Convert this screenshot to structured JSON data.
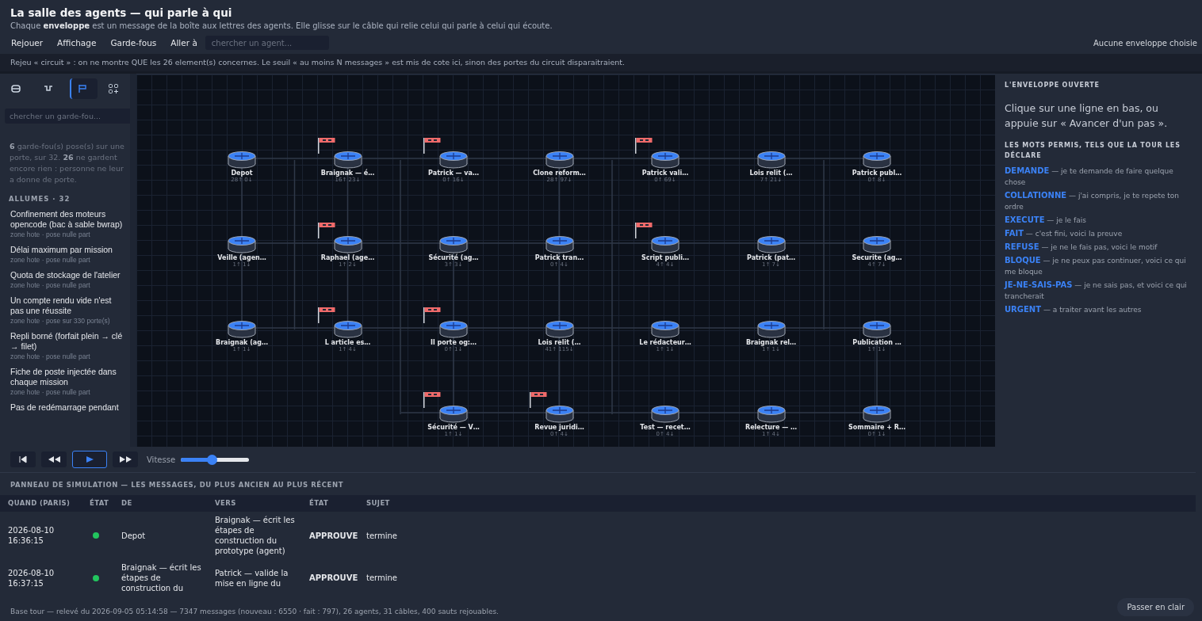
{
  "header": {
    "title": "La salle des agents — qui parle à qui",
    "subtitle": "Chaque **enveloppe** est un message de la boîte aux lettres des agents. Elle glisse sur le câble qui relie celui qui parle à celui qui écoute."
  },
  "menu": {
    "items": [
      "Rejouer",
      "Affichage",
      "Garde-fous",
      "Aller à"
    ],
    "search_placeholder": "chercher un agent...",
    "selection": "Aucune enveloppe choisie"
  },
  "notice": "Rejeu « circuit » : on ne montre QUE les 26 element(s) concernes. Le seuil « au moins N messages » est mis de cote ici, sinon des portes du circuit disparaitraient.",
  "sidebar": {
    "tools": [
      {
        "kind": "agents",
        "selected": false
      },
      {
        "kind": "cables",
        "selected": false
      },
      {
        "kind": "guards",
        "selected": true
      },
      {
        "kind": "grid",
        "selected": false
      }
    ],
    "search_placeholder": "chercher un garde-fou...",
    "summary": "**6** garde-fou(s) pose(s) sur une porte, sur 32. **26** ne gardent encore rien : personne ne leur a donne de porte.",
    "section": "ALLUMES · 32",
    "items": [
      {
        "title": "Confinement des moteurs opencode (bac à sable bwrap)",
        "meta": "zone hote · pose nulle part"
      },
      {
        "title": "Délai maximum par mission",
        "meta": "zone hote · pose nulle part"
      },
      {
        "title": "Quota de stockage de l'atelier",
        "meta": "zone hote · pose nulle part"
      },
      {
        "title": "Un compte rendu vide n'est pas une réussite",
        "meta": "zone hote · pose sur 330 porte(s)"
      },
      {
        "title": "Repli borné (forfait plein → clé → filet)",
        "meta": "zone hote · pose nulle part"
      },
      {
        "title": "Fiche de poste injectée dans chaque mission",
        "meta": "zone hote · pose nulle part"
      },
      {
        "title": "Pas de redémarrage pendant"
      }
    ]
  },
  "graph": {
    "rows": [
      [
        {
          "label": "Depot",
          "counts": "28↑ 0↓",
          "guarded": false
        },
        {
          "label": "Braignak — é…",
          "counts": "16↑ 23↓",
          "guarded": true
        },
        {
          "label": "Patrick — va…",
          "counts": "0↑ 16↓",
          "guarded": true
        },
        {
          "label": "Clone reform…",
          "counts": "28↑ 97↓",
          "guarded": false
        },
        {
          "label": "Patrick vali…",
          "counts": "0↑ 69↓",
          "guarded": true
        },
        {
          "label": "Lois relit (…",
          "counts": "7↑ 21↓",
          "guarded": false
        },
        {
          "label": "Patrick publ…",
          "counts": "0↑ 8↓",
          "guarded": false
        }
      ],
      [
        {
          "label": "Veille (agen…",
          "counts": "1↑ 1↓",
          "guarded": false
        },
        {
          "label": "Raphael (age…",
          "counts": "1↑ 2↓",
          "guarded": true
        },
        {
          "label": "Sécurité (ag…",
          "counts": "3↑ 3↓",
          "guarded": false
        },
        {
          "label": "Patrick tran…",
          "counts": "0↑ 4↓",
          "guarded": false
        },
        {
          "label": "Script publi…",
          "counts": "4↑ 4↓",
          "guarded": true
        },
        {
          "label": "Patrick (pat…",
          "counts": "1↑ 7↓",
          "guarded": false
        },
        {
          "label": "Securite (ag…",
          "counts": "4↑ 7↓",
          "guarded": false
        }
      ],
      [
        {
          "label": "Braignak (ag…",
          "counts": "1↑ 1↓",
          "guarded": false
        },
        {
          "label": "L article es…",
          "counts": "1↑ 4↓",
          "guarded": true
        },
        {
          "label": "Il porte og:…",
          "counts": "0↑ 1↓",
          "guarded": true
        },
        {
          "label": "Lois relit (…",
          "counts": "41↑ 115↓",
          "guarded": false
        },
        {
          "label": "Le rédacteur…",
          "counts": "1↑ 1↓",
          "guarded": false
        },
        {
          "label": "Braignak rel…",
          "counts": "1↑ 1↓",
          "guarded": false
        },
        {
          "label": "Publication …",
          "counts": "1↑ 1↓",
          "guarded": false
        }
      ],
      [
        null,
        null,
        {
          "label": "Sécurité — V…",
          "counts": "1↑ 1↓",
          "guarded": true
        },
        {
          "label": "Revue juridi…",
          "counts": "0↑ 4↓",
          "guarded": true
        },
        {
          "label": "Test — recet…",
          "counts": "0↑ 4↓",
          "guarded": false
        },
        {
          "label": "Relecture — …",
          "counts": "1↑ 4↓",
          "guarded": false
        },
        {
          "label": "Sommaire + R…",
          "counts": "0↑ 1↓",
          "guarded": false
        }
      ]
    ]
  },
  "player": {
    "buttons": [
      {
        "kind": "first",
        "selected": false
      },
      {
        "kind": "back",
        "selected": false
      },
      {
        "kind": "play",
        "selected": true
      },
      {
        "kind": "forward",
        "selected": false
      }
    ],
    "speed_label": "Vitesse",
    "level": 0.45
  },
  "envelope": {
    "heading": "L'ENVELOPPE OUVERTE",
    "hint": "Clique sur une ligne en bas, ou appuie sur « Avancer d'un pas ».",
    "words_heading": "LES MOTS PERMIS, TELS QUE LA TOUR LES DÉCLARE",
    "words": [
      "**DEMANDE** — je te demande de faire quelque chose",
      "**COLLATIONNE** — j'ai compris, je te repete ton ordre",
      "**EXECUTE** — je le fais",
      "**FAIT** — c'est fini, voici la preuve",
      "**REFUSE** — je ne le fais pas, voici le motif",
      "**BLOQUE** — je ne peux pas continuer, voici ce qui me bloque",
      "**JE-NE-SAIS-PAS** — je ne sais pas, et voici ce qui trancherait",
      "**URGENT** — a traiter avant les autres"
    ]
  },
  "simulation": {
    "title": "PANNEAU DE SIMULATION — LES MESSAGES, DU PLUS ANCIEN AU PLUS RÉCENT",
    "columns": [
      "QUAND (PARIS)",
      "ÉTAT",
      "DE",
      "VERS",
      "ÉTAT",
      "SUJET"
    ],
    "rows": [
      {
        "when": "2026-08-10 16:36:15",
        "color": "#22c55e",
        "from": "Depot",
        "to": "Braignak — écrit les étapes de construction du prototype (agent)",
        "verdict": "APPROUVE",
        "subject": "termine"
      },
      {
        "when": "2026-08-10 16:37:15",
        "color": "#22c55e",
        "from": "Braignak — écrit les étapes de construction du",
        "to": "Patrick — valide la mise en ligne du",
        "verdict": "APPROUVE",
        "subject": "termine"
      }
    ]
  },
  "footer": "Base tour — relevé du 2026-09-05 05:14:58 — 7347 messages (nouveau : 6550 · fait : 797), 26 agents, 31 câbles, 400 sauts rejouables.",
  "contrast_button": "Passer en clair"
}
